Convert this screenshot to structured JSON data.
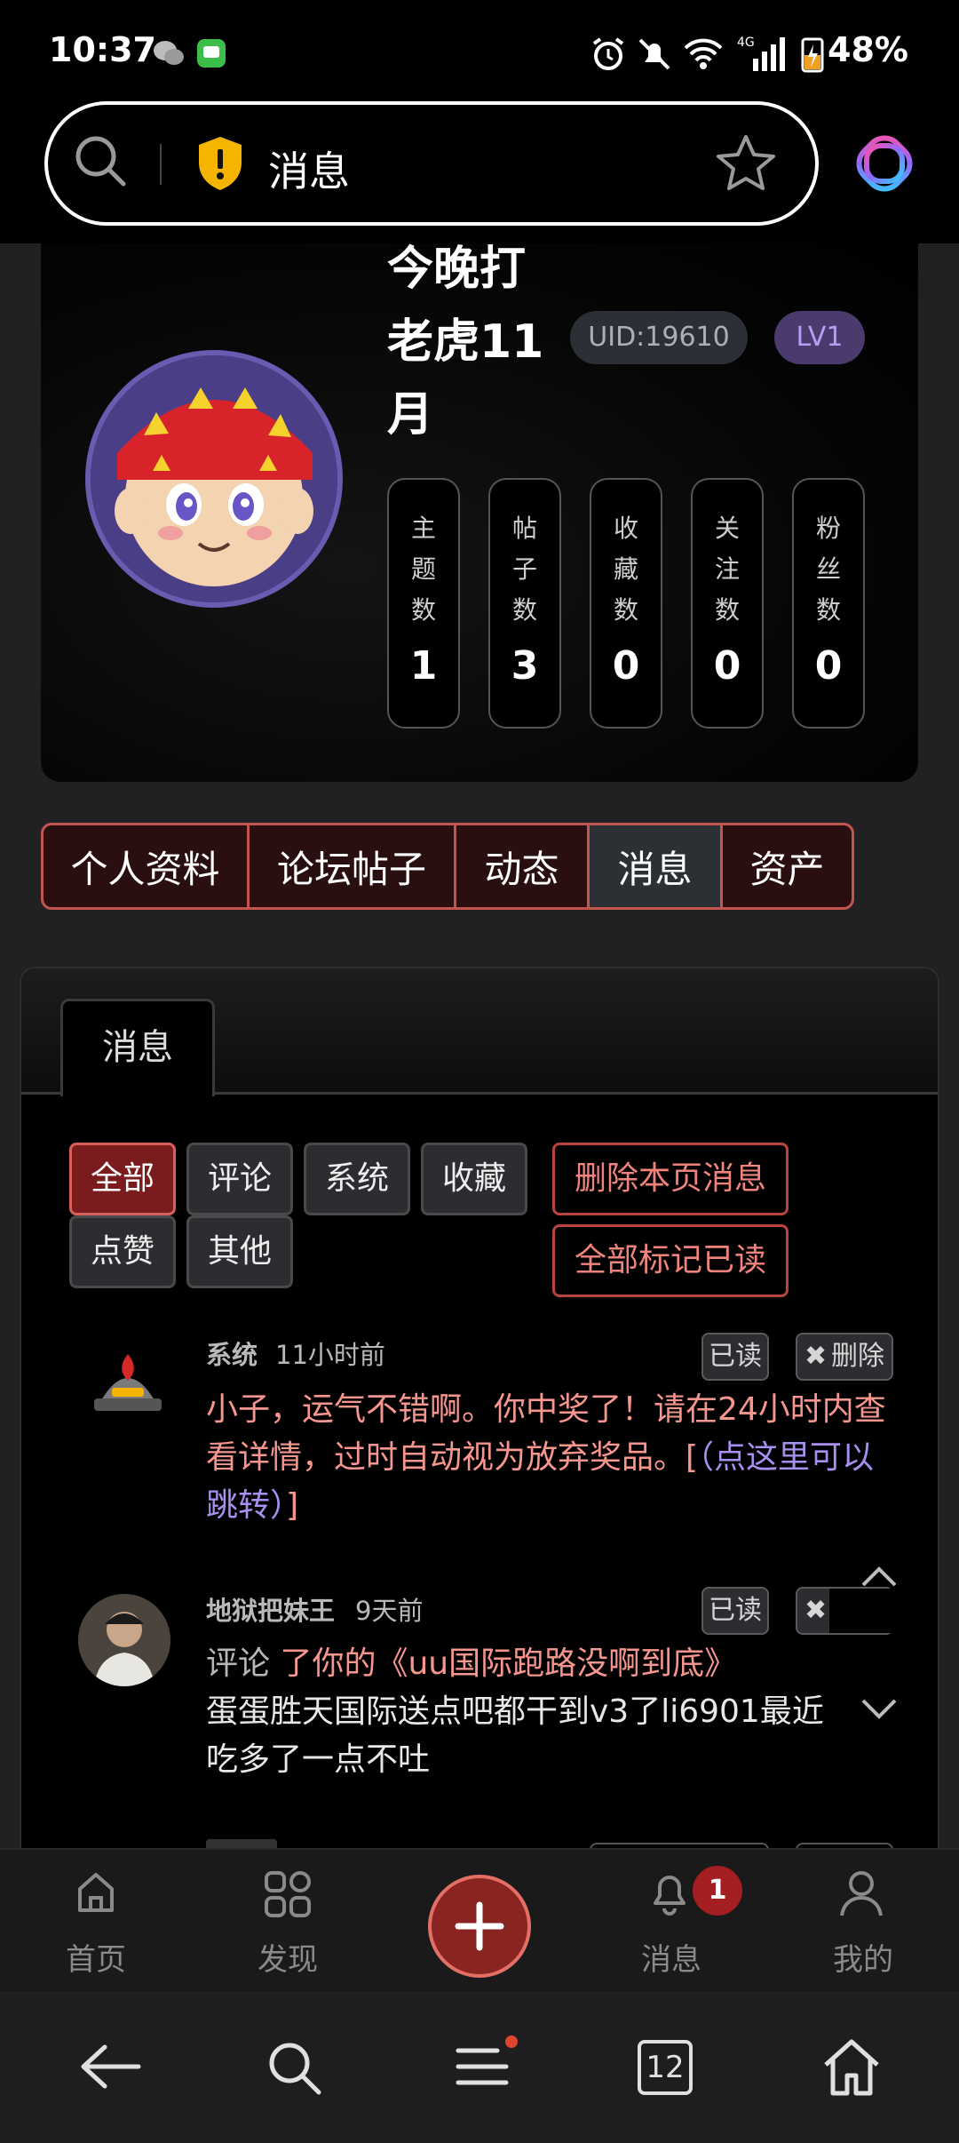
{
  "status_bar": {
    "time": "10:37",
    "battery": "48%"
  },
  "url_bar": {
    "text": "消息"
  },
  "profile": {
    "name": "今晚打老虎11月",
    "uid": "UID:19610",
    "level": "LV1",
    "stats": [
      {
        "label": "主题数",
        "value": "1"
      },
      {
        "label": "帖子数",
        "value": "3"
      },
      {
        "label": "收藏数",
        "value": "0"
      },
      {
        "label": "关注数",
        "value": "0"
      },
      {
        "label": "粉丝数",
        "value": "0"
      }
    ]
  },
  "profile_tabs": [
    {
      "label": "个人资料"
    },
    {
      "label": "论坛帖子"
    },
    {
      "label": "动态"
    },
    {
      "label": "消息",
      "active": true
    },
    {
      "label": "资产"
    }
  ],
  "panel": {
    "tab": "消息",
    "filters": [
      "全部",
      "评论",
      "系统",
      "收藏",
      "点赞",
      "其他"
    ],
    "active_filter": "全部",
    "actions": {
      "delete_page": "删除本页消息",
      "mark_all_read": "全部标记已读"
    }
  },
  "messages": [
    {
      "name": "系统",
      "time": "11小时前",
      "read_label": "已读",
      "delete_label": "删除",
      "body_main": "小子，运气不错啊。你中奖了！请在24小时内查看详情，过时自动视为放弃奖品。[",
      "body_link": "（点这里可以跳转）",
      "body_end": "]"
    },
    {
      "name": "地狱把妹王",
      "time": "9天前",
      "read_label": "已读",
      "action": "评论",
      "target": "了你的《uu国际跑路没啊到底》",
      "content": "蛋蛋胜天国际送点吧都干到v3了li6901最近吃多了一点不吐"
    }
  ],
  "bottom_nav": [
    {
      "label": "首页",
      "icon": "home-icon"
    },
    {
      "label": "发现",
      "icon": "grid-icon"
    },
    {
      "label": "消息",
      "icon": "bell-icon",
      "badge": "1"
    },
    {
      "label": "我的",
      "icon": "user-icon"
    }
  ],
  "system_nav": {
    "tab_count": "12"
  },
  "colors": {
    "accent": "#c2564e",
    "pink_text": "#f7968e",
    "link": "#a88ff0",
    "badge": "#a31f22"
  }
}
